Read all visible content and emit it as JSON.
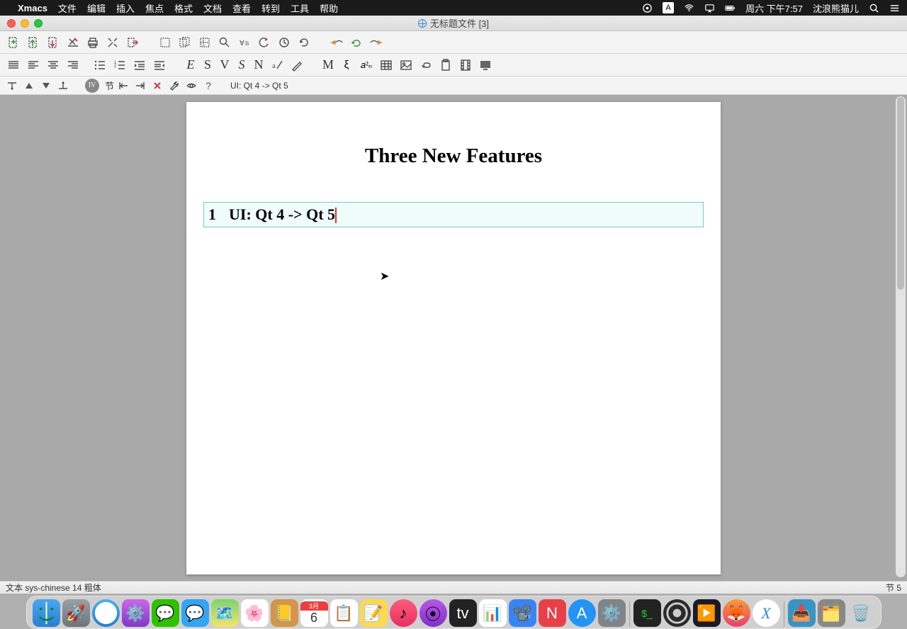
{
  "menubar": {
    "app_name": "Xmacs",
    "items": [
      "文件",
      "编辑",
      "插入",
      "焦点",
      "格式",
      "文档",
      "查看",
      "转到",
      "工具",
      "帮助"
    ],
    "day_time": "周六 下午7:57",
    "user": "沈浪熊猫儿",
    "input_indicator": "A"
  },
  "titlebar": {
    "title": "无标题文件 [3]"
  },
  "toolbar3": {
    "chapter_badge": "IV",
    "section_label": "节",
    "breadcrumb": "UI: Qt 4 -> Qt 5"
  },
  "document": {
    "title": "Three New Features",
    "section_number": "1",
    "section_text": "UI: Qt 4 -> Qt 5"
  },
  "statusbar": {
    "left": "文本 sys-chinese 14 粗体",
    "right": "节 5"
  },
  "format_letters": {
    "E": "E",
    "S1": "S",
    "V": "V",
    "S2": "S",
    "N": "N"
  },
  "row2_extras": {
    "M": "M",
    "xi": "ξ",
    "eq": "𝑎²ₙ"
  }
}
